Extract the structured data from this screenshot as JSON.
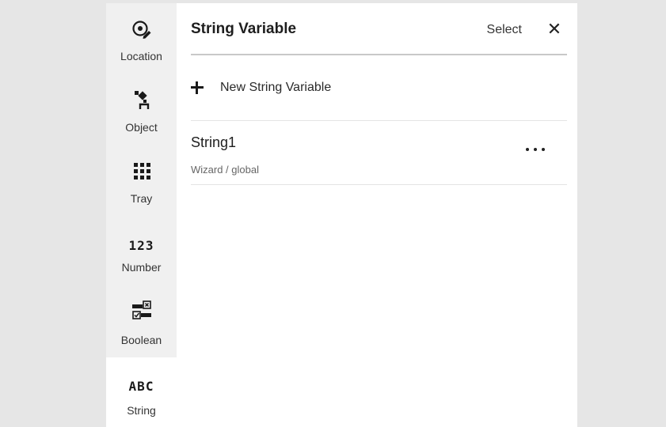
{
  "sidebar": {
    "items": [
      {
        "label": "Location",
        "icon": "location-pin-edit-icon"
      },
      {
        "label": "Object",
        "icon": "robot-gripper-icon"
      },
      {
        "label": "Tray",
        "icon": "tray-grid-icon"
      },
      {
        "label": "Number",
        "icon": "number-123-icon",
        "glyph": "123"
      },
      {
        "label": "Boolean",
        "icon": "boolean-toggle-icon"
      },
      {
        "label": "String",
        "icon": "string-abc-icon",
        "glyph": "ABC",
        "active": true
      }
    ]
  },
  "header": {
    "title": "String Variable",
    "select_label": "Select",
    "close_glyph": "✕"
  },
  "new_variable": {
    "label": "New String Variable"
  },
  "variables": [
    {
      "name": "String1",
      "scope": "Wizard / global"
    }
  ]
}
